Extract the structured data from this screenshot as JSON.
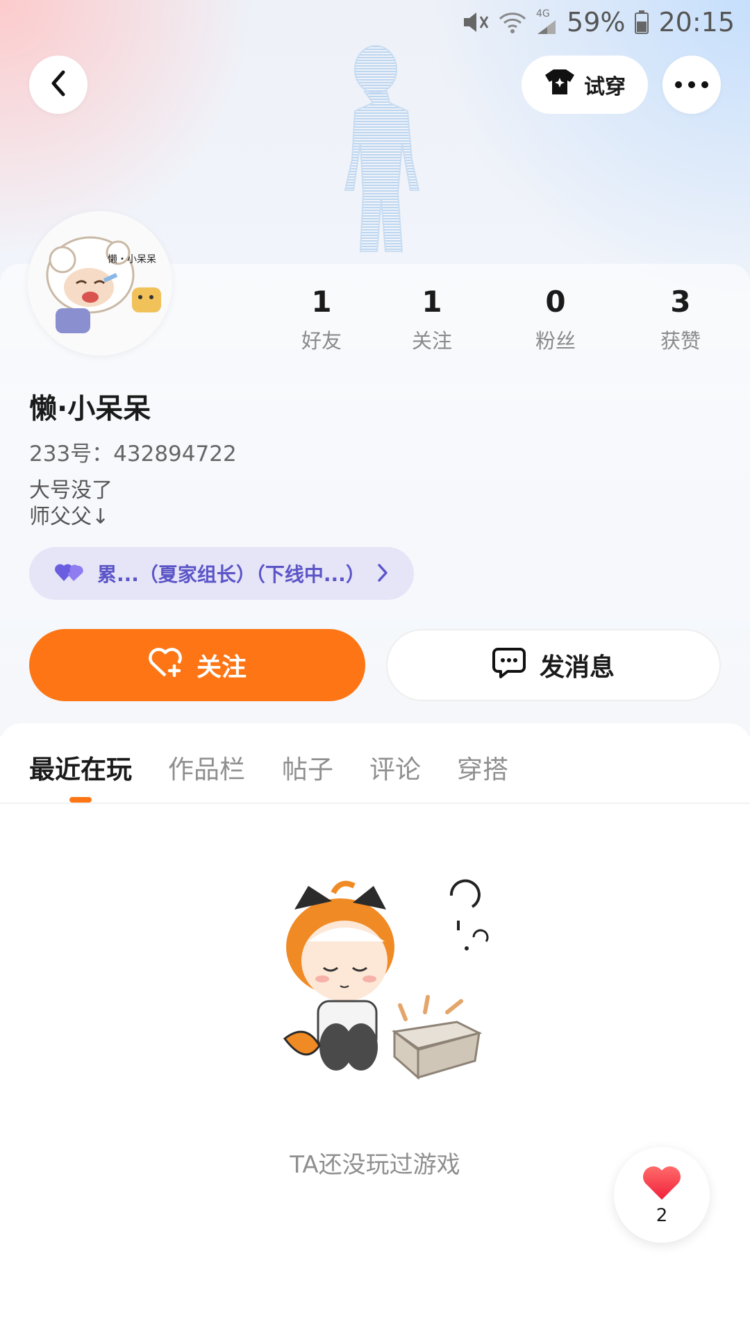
{
  "status_bar": {
    "battery": "59%",
    "time": "20:15",
    "network": "4G"
  },
  "header": {
    "tryon_label": "试穿"
  },
  "profile": {
    "nickname": "懒·小呆呆",
    "uid_label": "233号：432894722",
    "bio_lines": [
      "大号没了",
      "师父父↓"
    ],
    "avatar_caption": "懒・小呆呆"
  },
  "stats": [
    {
      "value": "1",
      "label": "好友"
    },
    {
      "value": "1",
      "label": "关注"
    },
    {
      "value": "0",
      "label": "粉丝"
    },
    {
      "value": "3",
      "label": "获赞"
    }
  ],
  "relation_chip": {
    "text": "累...（夏家组长）（下线中...）",
    "color": "#5b55c7"
  },
  "actions": {
    "follow_label": "关注",
    "message_label": "发消息",
    "accent": "#fd7514"
  },
  "tabs": [
    {
      "label": "最近在玩",
      "active": true
    },
    {
      "label": "作品栏",
      "active": false
    },
    {
      "label": "帖子",
      "active": false
    },
    {
      "label": "评论",
      "active": false
    },
    {
      "label": "穿搭",
      "active": false
    }
  ],
  "empty_state": {
    "text": "TA还没玩过游戏"
  },
  "like_fab": {
    "count": "2"
  }
}
